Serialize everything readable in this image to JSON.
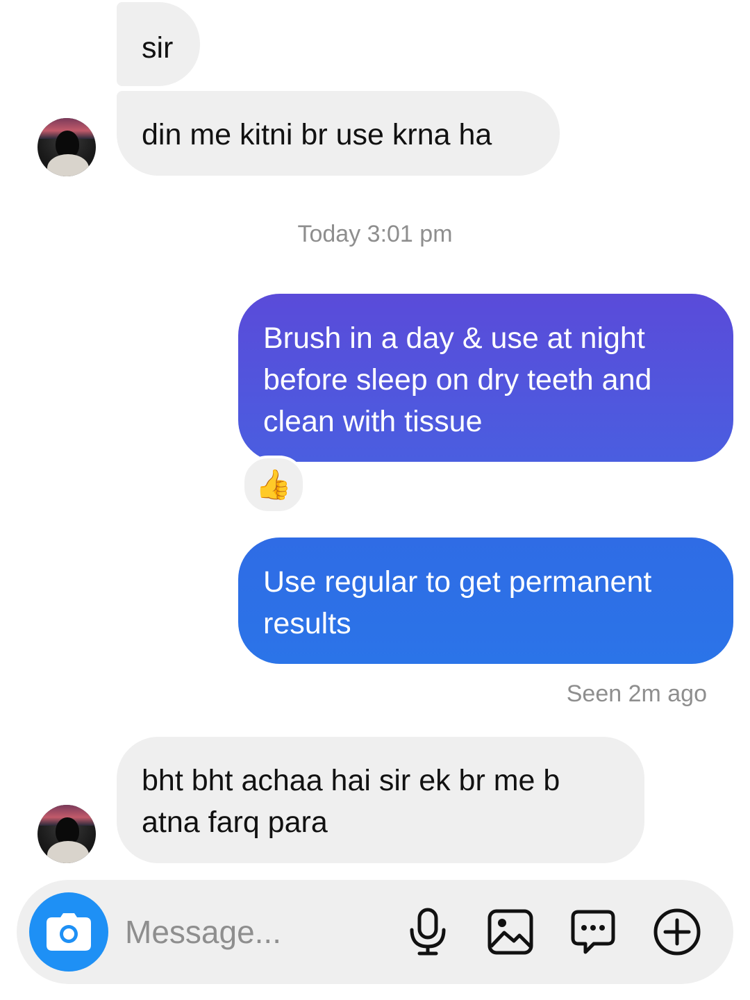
{
  "messages": [
    {
      "id": "sir",
      "from": "them",
      "text": "sir"
    },
    {
      "id": "din",
      "from": "them",
      "text": "din me kitni br use krna ha"
    },
    {
      "id": "brush",
      "from": "me",
      "text": "Brush in a day & use at night before sleep on dry teeth and clean with tissue",
      "reaction": "👍"
    },
    {
      "id": "regular",
      "from": "me",
      "text": "Use regular to get permanent results"
    },
    {
      "id": "bht",
      "from": "them",
      "text": "bht bht achaa hai sir ek br me b atna farq para"
    }
  ],
  "timestamp": "Today 3:01 pm",
  "seen_status": "Seen 2m ago",
  "composer": {
    "placeholder": "Message...",
    "icons": [
      "camera-icon",
      "microphone-icon",
      "gallery-icon",
      "sticker-icon",
      "plus-icon"
    ]
  },
  "colors": {
    "incoming_bubble": "#efefef",
    "outgoing_bubble_top": "#5a4bd9",
    "outgoing_bubble_bottom": "#2b74e8",
    "camera_button": "#1e90f5",
    "meta_text": "#8e8e8e"
  }
}
